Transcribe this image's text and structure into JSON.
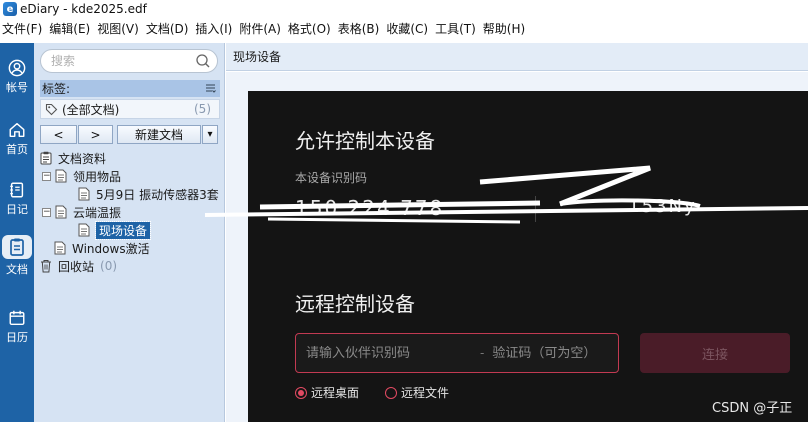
{
  "window": {
    "title": "eDiary - kde2025.edf",
    "logo_letter": "e"
  },
  "menu": [
    "文件(F)",
    "编辑(E)",
    "视图(V)",
    "文档(D)",
    "插入(I)",
    "附件(A)",
    "格式(O)",
    "表格(B)",
    "收藏(C)",
    "工具(T)",
    "帮助(H)"
  ],
  "nav": {
    "account": "帐号",
    "home": "首页",
    "diary": "日记",
    "docs": "文档",
    "calendar": "日历"
  },
  "sidebar": {
    "search_placeholder": "搜索",
    "tags_header": "标签:",
    "all_docs": "(全部文档)",
    "all_docs_count": "(5)",
    "prev": "<",
    "next": ">",
    "new_doc": "新建文档",
    "dropdown": "▾"
  },
  "tree": {
    "root": "文档资料",
    "items": {
      "supplies": "领用物品",
      "supplies_child": "5月9日 振动传感器3套",
      "cloud": "云端温振",
      "cloud_child": "现场设备",
      "windows": "Windows激活",
      "recycle": "回收站",
      "recycle_count": "(0)"
    }
  },
  "content": {
    "header": "现场设备",
    "allow_title": "允许控制本设备",
    "device_id_label": "本设备识别码",
    "device_id_value": "150 224 778",
    "device_code_value": "...153Ny",
    "remote_title": "远程控制设备",
    "partner_placeholder": "请输入伙伴识别码",
    "separator": "-",
    "code_placeholder": "验证码（可为空）",
    "connect": "连接",
    "option_desktop": "远程桌面",
    "option_file": "远程文件"
  },
  "watermark": "CSDN @子正",
  "colors": {
    "nav": "#1e63a6",
    "panel": "#d6e3f3",
    "dark": "#141414",
    "accent": "#e24a62"
  }
}
